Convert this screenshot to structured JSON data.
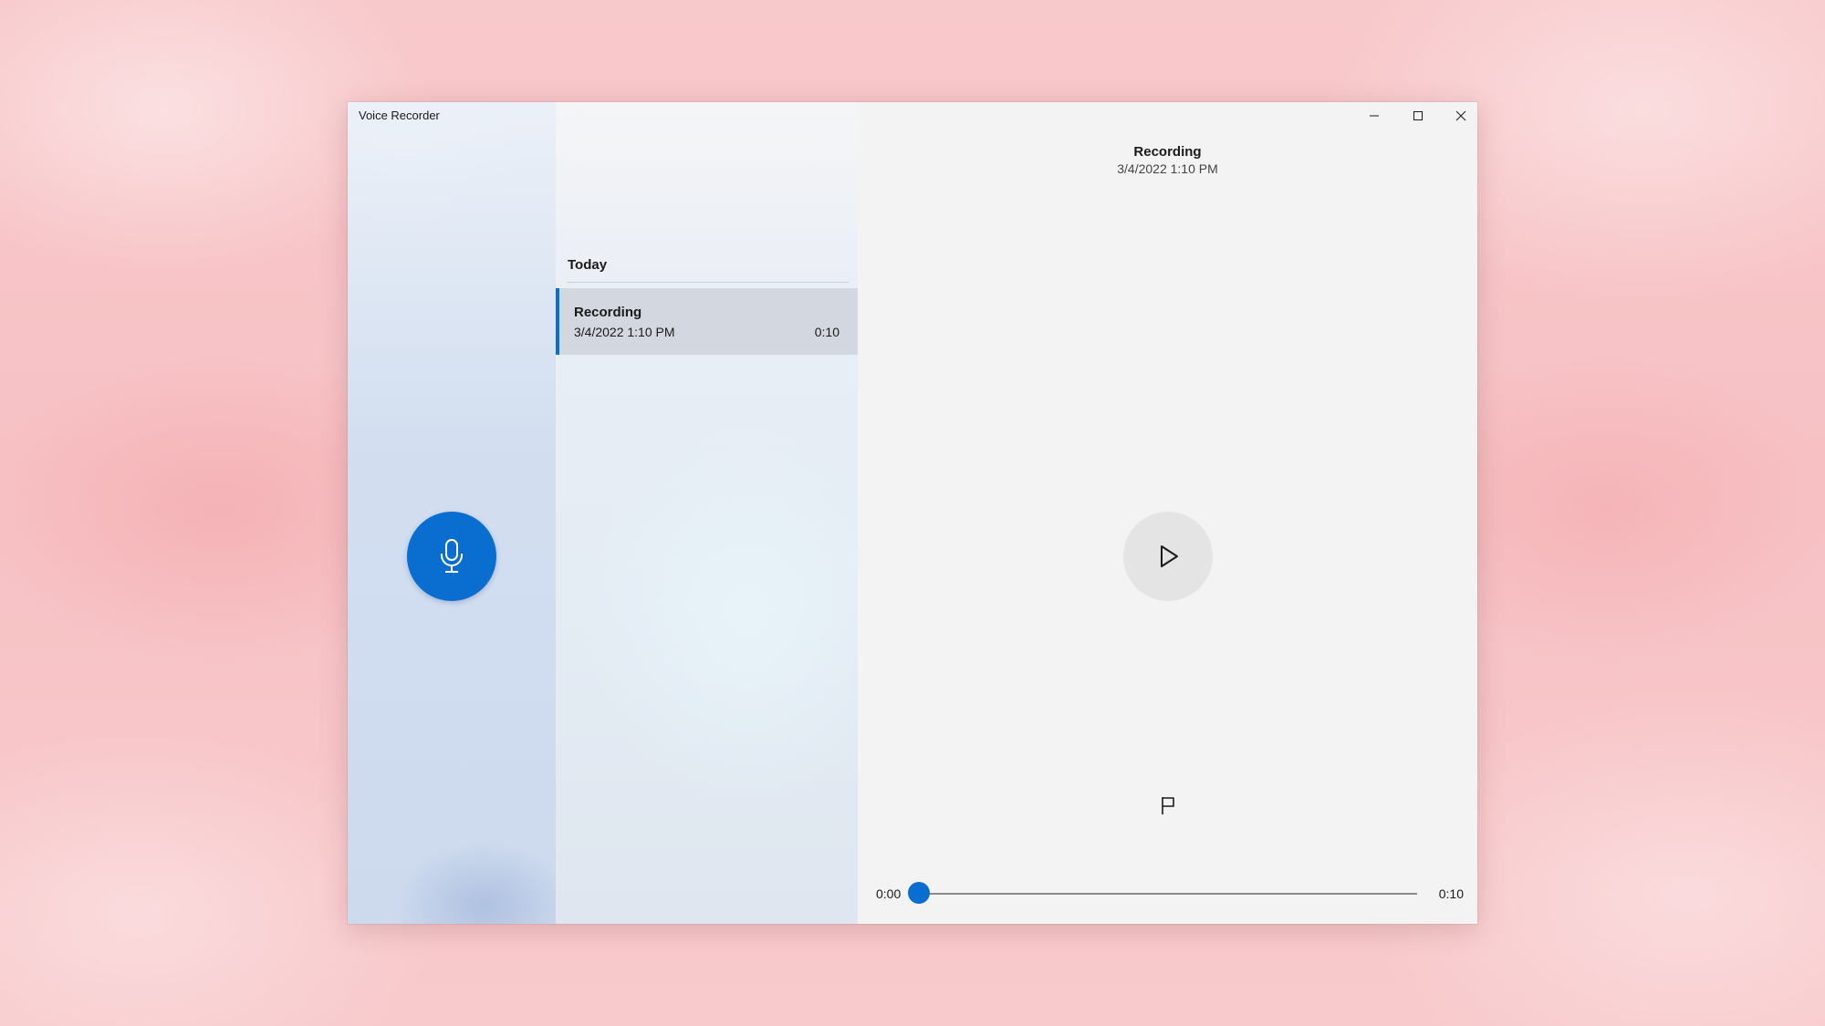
{
  "window": {
    "title": "Voice Recorder"
  },
  "title_bar": {
    "controls": [
      "minimize-icon",
      "maximize-icon",
      "close-icon"
    ]
  },
  "record": {
    "icon": "microphone-icon",
    "accent_color": "#0a6ed1"
  },
  "list": {
    "section_header": "Today",
    "items": [
      {
        "name": "Recording",
        "date": "3/4/2022 1:10 PM",
        "duration": "0:10",
        "selected": true
      }
    ]
  },
  "detail": {
    "title": "Recording",
    "date": "3/4/2022 1:10 PM",
    "play_icon": "play-icon",
    "marker_icon": "flag-icon"
  },
  "playback": {
    "current_time": "0:00",
    "total_time": "0:10",
    "progress_fraction": 0.0
  }
}
